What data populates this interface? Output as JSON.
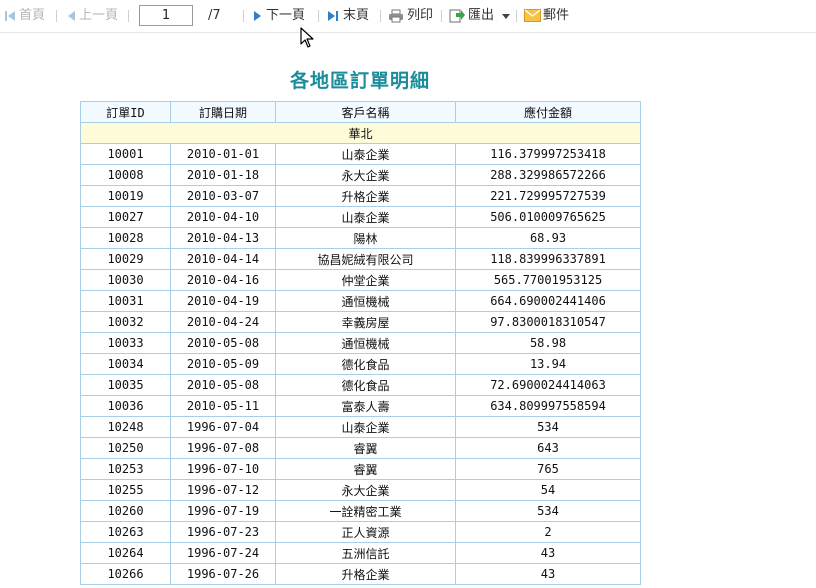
{
  "toolbar": {
    "first_label": "首頁",
    "prev_label": "上一頁",
    "current_page": "1",
    "total_pages": "/7",
    "next_label": "下一頁",
    "last_label": "末頁",
    "print_label": "列印",
    "export_label": "匯出",
    "mail_label": "郵件"
  },
  "report": {
    "title": "各地區訂單明細",
    "columns": [
      "訂單ID",
      "訂購日期",
      "客戶名稱",
      "應付金額"
    ],
    "group_label": "華北",
    "rows": [
      [
        "10001",
        "2010-01-01",
        "山泰企業",
        "116.379997253418"
      ],
      [
        "10008",
        "2010-01-18",
        "永大企業",
        "288.329986572266"
      ],
      [
        "10019",
        "2010-03-07",
        "升格企業",
        "221.729995727539"
      ],
      [
        "10027",
        "2010-04-10",
        "山泰企業",
        "506.010009765625"
      ],
      [
        "10028",
        "2010-04-13",
        "陽林",
        "68.93"
      ],
      [
        "10029",
        "2010-04-14",
        "協昌妮絨有限公司",
        "118.839996337891"
      ],
      [
        "10030",
        "2010-04-16",
        "仲堂企業",
        "565.77001953125"
      ],
      [
        "10031",
        "2010-04-19",
        "通恒機械",
        "664.690002441406"
      ],
      [
        "10032",
        "2010-04-24",
        "幸義房屋",
        "97.8300018310547"
      ],
      [
        "10033",
        "2010-05-08",
        "通恒機械",
        "58.98"
      ],
      [
        "10034",
        "2010-05-09",
        "德化食品",
        "13.94"
      ],
      [
        "10035",
        "2010-05-08",
        "德化食品",
        "72.6900024414063"
      ],
      [
        "10036",
        "2010-05-11",
        "富泰人壽",
        "634.809997558594"
      ],
      [
        "10248",
        "1996-07-04",
        "山泰企業",
        "534"
      ],
      [
        "10250",
        "1996-07-08",
        "睿翼",
        "643"
      ],
      [
        "10253",
        "1996-07-10",
        "睿翼",
        "765"
      ],
      [
        "10255",
        "1996-07-12",
        "永大企業",
        "54"
      ],
      [
        "10260",
        "1996-07-19",
        "一詮精密工業",
        "534"
      ],
      [
        "10263",
        "1996-07-23",
        "正人資源",
        "2"
      ],
      [
        "10264",
        "1996-07-24",
        "五洲信託",
        "43"
      ],
      [
        "10266",
        "1996-07-26",
        "升格企業",
        "43"
      ]
    ]
  },
  "colors": {
    "title": "#1a8c9a",
    "nav_icon_enabled": "#2f7fc9",
    "nav_icon_disabled": "#a8c4de",
    "grid_border": "#a9cfe6",
    "group_row_bg": "#fdfbd8",
    "header_bg": "#f2f9ff"
  },
  "icons": {
    "first": "first-page-icon",
    "prev": "previous-page-icon",
    "next": "next-page-icon",
    "last": "last-page-icon",
    "print": "printer-icon",
    "export": "export-icon",
    "mail": "envelope-icon",
    "cursor": "mouse-pointer-icon"
  }
}
